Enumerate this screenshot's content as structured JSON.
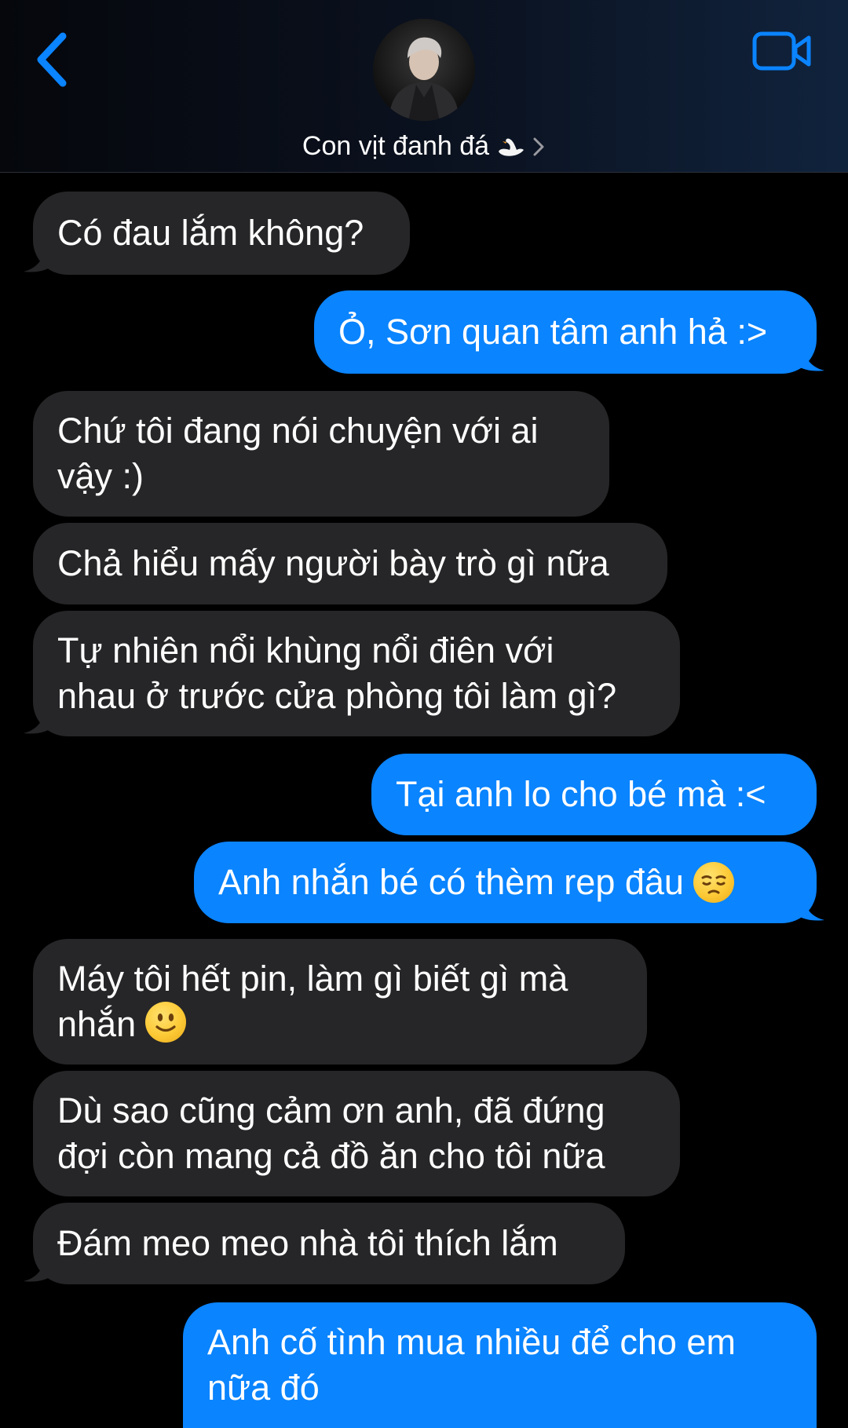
{
  "header": {
    "contact_name": "Con vịt đanh đá",
    "name_emoji": "swan-icon"
  },
  "messages": [
    {
      "side": "received",
      "text": "Có đau lắm không?"
    },
    {
      "side": "sent",
      "text": "Ỏ, Sơn quan tâm anh hả :>"
    },
    {
      "side": "received",
      "line1": "Chứ tôi đang nói chuyện với ai",
      "line2": "vậy :)"
    },
    {
      "side": "received",
      "text": "Chả hiểu mấy người bày trò gì nữa"
    },
    {
      "side": "received",
      "line1": "Tự nhiên nổi khùng nổi điên với",
      "line2": "nhau ở trước cửa phòng tôi làm gì?"
    },
    {
      "side": "sent",
      "text": "Tại anh lo cho bé mà :<"
    },
    {
      "side": "sent",
      "text": "Anh nhắn bé có thèm rep đâu",
      "emoji": "pensive-face-emoji"
    },
    {
      "side": "received",
      "line1": "Máy tôi hết pin, làm gì biết gì mà",
      "line2": "nhắn",
      "emoji": "slightly-smiling-face-emoji"
    },
    {
      "side": "received",
      "line1": "Dù sao cũng cảm ơn anh, đã đứng",
      "line2": "đợi còn mang cả đồ ăn cho tôi nữa"
    },
    {
      "side": "received",
      "text": "Đám meo meo nhà tôi thích lắm"
    },
    {
      "side": "sent",
      "line1": "Anh cố tình mua nhiều để cho em",
      "line2": "nữa đó"
    }
  ],
  "colors": {
    "received_bubble": "#262628",
    "sent_bubble": "#0a84ff",
    "accent": "#0a84ff",
    "background": "#000000"
  }
}
